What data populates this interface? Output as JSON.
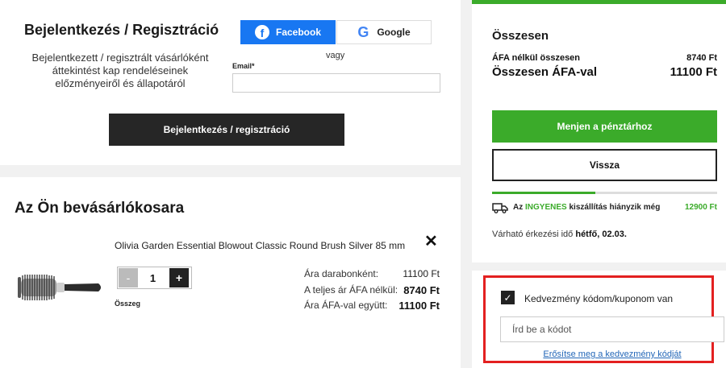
{
  "login": {
    "title": "Bejelentkezés / Regisztráció",
    "description": "Bejelentkezett / regisztrált vásárlóként áttekintést kap rendeléseinek előzményeiről és állapotáról",
    "facebook_label": "Facebook",
    "facebook_icon_glyph": "f",
    "google_label": "Google",
    "google_icon_glyph": "G",
    "or_text": "vagy",
    "email_label": "Email*",
    "email_value": "",
    "submit_label": "Bejelentkezés / regisztráció"
  },
  "cart": {
    "title": "Az Ön bevásárlókosara",
    "product": {
      "name": "Olivia Garden Essential Blowout Classic Round Brush Silver 85 mm",
      "quantity": "1",
      "minus_label": "-",
      "plus_label": "+",
      "sum_label": "Összeg",
      "remove_glyph": "✕",
      "prices": [
        {
          "label": "Ára darabonként:",
          "value": "11100 Ft",
          "bold": false
        },
        {
          "label": "A teljes ár ÁFA nélkül:",
          "value": "8740 Ft",
          "bold": true
        },
        {
          "label": "Ára ÁFA-val együtt:",
          "value": "11100 Ft",
          "bold": true
        }
      ]
    }
  },
  "summary": {
    "title": "Összesen",
    "net_label": "ÁFA nélkül összesen",
    "net_value": "8740 Ft",
    "gross_label": "Összesen ÁFA-val",
    "gross_value": "11100 Ft",
    "checkout_label": "Menjen a pénztárhoz",
    "back_label": "Vissza",
    "shipping": {
      "prefix": "Az",
      "highlight": "INGYENES",
      "suffix": "kiszállítás hiányzik még",
      "amount": "12900 Ft",
      "progress_fraction": 0.46
    },
    "delivery": {
      "label": "Várható érkezési idő",
      "date": "hétfő, 02.03."
    }
  },
  "coupon": {
    "checked": true,
    "check_glyph": "✓",
    "label": "Kedvezmény kódom/kuponom van",
    "input_placeholder": "Írd be a kódot",
    "confirm_link": "Erősítse meg a kedvezmény kódját",
    "highlight_color": "#e32020"
  },
  "colors": {
    "brand_green": "#3bab2a",
    "facebook_blue": "#1877f2",
    "dark_button": "#262626"
  }
}
